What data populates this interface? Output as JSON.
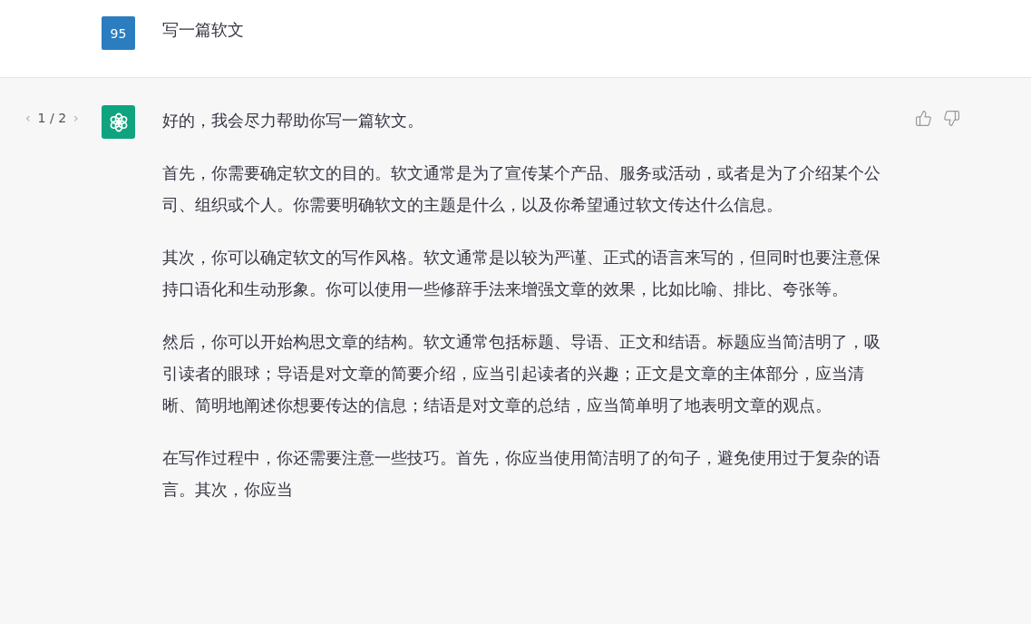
{
  "user_message": {
    "avatar": "95",
    "text": "写一篇软文"
  },
  "assistant_message": {
    "pager": {
      "prev": "‹",
      "label": "1 / 2",
      "next": "›"
    },
    "paragraphs": [
      "好的，我会尽力帮助你写一篇软文。",
      "首先，你需要确定软文的目的。软文通常是为了宣传某个产品、服务或活动，或者是为了介绍某个公司、组织或个人。你需要明确软文的主题是什么，以及你希望通过软文传达什么信息。",
      "其次，你可以确定软文的写作风格。软文通常是以较为严谨、正式的语言来写的，但同时也要注意保持口语化和生动形象。你可以使用一些修辞手法来增强文章的效果，比如比喻、排比、夸张等。",
      "然后，你可以开始构思文章的结构。软文通常包括标题、导语、正文和结语。标题应当简洁明了，吸引读者的眼球；导语是对文章的简要介绍，应当引起读者的兴趣；正文是文章的主体部分，应当清晰、简明地阐述你想要传达的信息；结语是对文章的总结，应当简单明了地表明文章的观点。",
      "在写作过程中，你还需要注意一些技巧。首先，你应当使用简洁明了的句子，避免使用过于复杂的语言。其次，你应当"
    ]
  }
}
